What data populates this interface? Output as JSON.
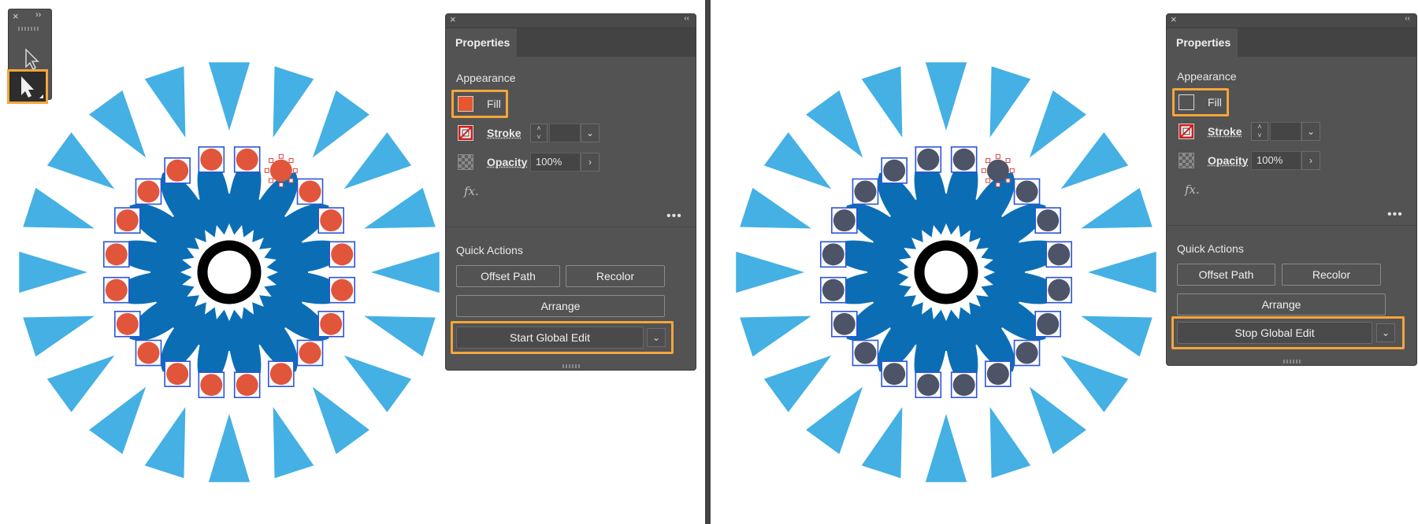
{
  "colors": {
    "accent_highlight": "#f4a63a",
    "ray": "#44b0e4",
    "flower": "#0b6eb5",
    "dot_left": "#e1553b",
    "dot_right": "#4d5468",
    "selection": "#2a55d8"
  },
  "toolbar": {
    "close_icon": "×",
    "collapse_icon": "››",
    "tools": [
      "direct-selection-tool",
      "selection-tool"
    ]
  },
  "left_panel": {
    "tab": "Properties",
    "appearance": "Appearance",
    "fill_label": "Fill",
    "fill_color": "#e8562d",
    "stroke_label": "Stroke",
    "opacity_label": "Opacity",
    "opacity_value": "100%",
    "fx": "fx.",
    "more": "•••",
    "quick_actions": "Quick Actions",
    "offset_path": "Offset Path",
    "recolor": "Recolor",
    "arrange": "Arrange",
    "global_edit": "Start Global Edit",
    "close_icon": "×",
    "collapse_icon": "‹‹"
  },
  "right_panel": {
    "tab": "Properties",
    "appearance": "Appearance",
    "fill_label": "Fill",
    "fill_color": "#535353",
    "stroke_label": "Stroke",
    "opacity_label": "Opacity",
    "opacity_value": "100%",
    "fx": "fx.",
    "more": "•••",
    "quick_actions": "Quick Actions",
    "offset_path": "Offset Path",
    "recolor": "Recolor",
    "arrange": "Arrange",
    "global_edit": "Stop Global Edit",
    "close_icon": "×",
    "collapse_icon": "‹‹"
  }
}
